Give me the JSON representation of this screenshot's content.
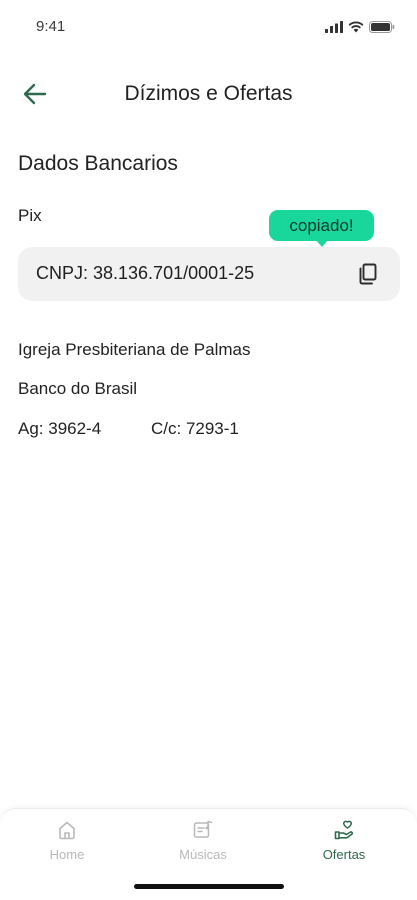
{
  "status_bar": {
    "time": "9:41",
    "icons": [
      "signal-icon",
      "wifi-icon",
      "battery-icon"
    ]
  },
  "header": {
    "back_icon": "arrow-left-icon",
    "title": "Dízimos e Ofertas"
  },
  "bank": {
    "section_title": "Dados Bancarios",
    "pix_label": "Pix",
    "pix_key": "CNPJ: 38.136.701/0001-25",
    "copy_icon": "copy-icon",
    "copied_tooltip": "copiado!",
    "church": "Igreja Presbiteriana de Palmas",
    "bank_name": "Banco do Brasil",
    "agency": "Ag: 3962-4",
    "account": "C/c: 7293-1"
  },
  "tab_bar": {
    "items": [
      {
        "label": "Home",
        "icon": "home-icon",
        "active": false
      },
      {
        "label": "Músicas",
        "icon": "music-icon",
        "active": false
      },
      {
        "label": "Ofertas",
        "icon": "offering-icon",
        "active": true
      }
    ]
  },
  "colors": {
    "accent": "#2e6a4e",
    "tooltip": "#19d69a",
    "card_bg": "#f1f1f1",
    "inactive_tab": "#b9b9b9"
  }
}
